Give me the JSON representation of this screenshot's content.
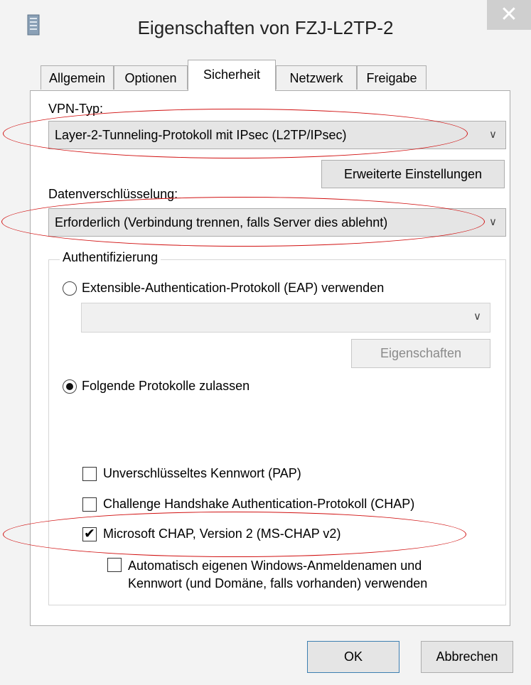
{
  "window": {
    "title": "Eigenschaften von FZJ-L2TP-2",
    "close_glyph": "✕"
  },
  "tabs": [
    {
      "label": "Allgemein",
      "active": false
    },
    {
      "label": "Optionen",
      "active": false
    },
    {
      "label": "Sicherheit",
      "active": true
    },
    {
      "label": "Netzwerk",
      "active": false
    },
    {
      "label": "Freigabe",
      "active": false
    }
  ],
  "vpn": {
    "label": "VPN-Typ:",
    "value": "Layer-2-Tunneling-Protokoll mit IPsec (L2TP/IPsec)",
    "advanced_button": "Erweiterte Einstellungen"
  },
  "encryption": {
    "label": "Datenverschlüsselung:",
    "value": "Erforderlich (Verbindung trennen, falls Server dies ablehnt)"
  },
  "auth": {
    "legend": "Authentifizierung",
    "eap_radio": {
      "label": "Extensible-Authentication-Protokoll (EAP) verwenden",
      "selected": false
    },
    "eap_combo_value": "",
    "eap_properties_button": "Eigenschaften",
    "protocols_radio": {
      "label": "Folgende Protokolle zulassen",
      "selected": true
    },
    "protocols": [
      {
        "label": "Unverschlüsseltes Kennwort (PAP)",
        "checked": false
      },
      {
        "label": "Challenge Handshake Authentication-Protokoll (CHAP)",
        "checked": false
      },
      {
        "label": "Microsoft CHAP, Version 2 (MS-CHAP v2)",
        "checked": true
      }
    ],
    "windows_logon": {
      "line1": "Automatisch eigenen Windows-Anmeldenamen und",
      "line2": "Kennwort (und Domäne, falls vorhanden) verwenden",
      "checked": false
    }
  },
  "footer": {
    "ok": "OK",
    "cancel": "Abbrechen"
  },
  "glyphs": {
    "dropdown": "∨",
    "checkmark": "✔"
  },
  "colors": {
    "annotation": "#d11111",
    "background": "#f3f3f3"
  }
}
